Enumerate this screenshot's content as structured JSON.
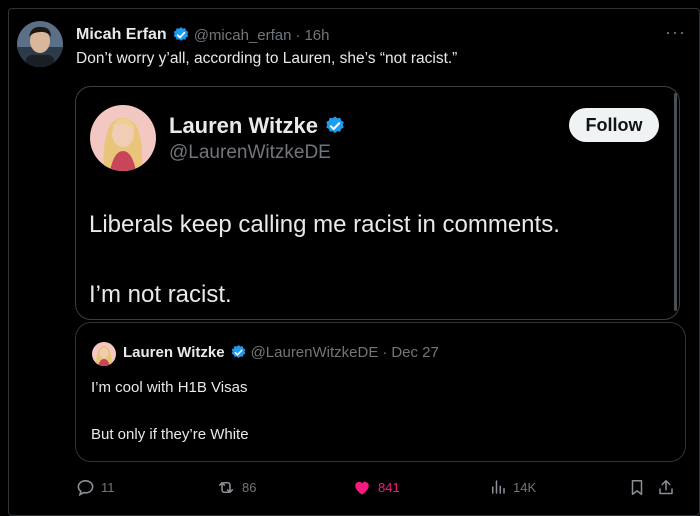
{
  "tweet": {
    "author_name": "Micah Erfan",
    "author_handle": "@micah_erfan",
    "separator": "·",
    "time": "16h",
    "text": "Don’t worry y’all, according to Lauren, she’s “not racist.”",
    "more_label": "···"
  },
  "quoted": {
    "author_name": "Lauren Witzke",
    "author_handle": "@LaurenWitzkeDE",
    "follow_label": "Follow",
    "line1": "Liberals keep calling me racist in comments.",
    "line2": "I’m not racist."
  },
  "nested": {
    "author_name": "Lauren Witzke",
    "author_handle": "@LaurenWitzkeDE",
    "separator": "·",
    "date": "Dec 27",
    "line1": "I’m cool with H1B Visas",
    "line2": "But only if they’re White"
  },
  "actions": {
    "replies": "11",
    "reposts": "86",
    "likes": "841",
    "views": "14K"
  },
  "icons": [
    "verified-badge-icon",
    "reply-icon",
    "repost-icon",
    "heart-icon",
    "views-icon",
    "bookmark-icon",
    "share-icon",
    "more-icon"
  ],
  "colors": {
    "background": "#000000",
    "accent": "#1d9bf0",
    "like": "#f91880",
    "muted": "#71767b"
  }
}
